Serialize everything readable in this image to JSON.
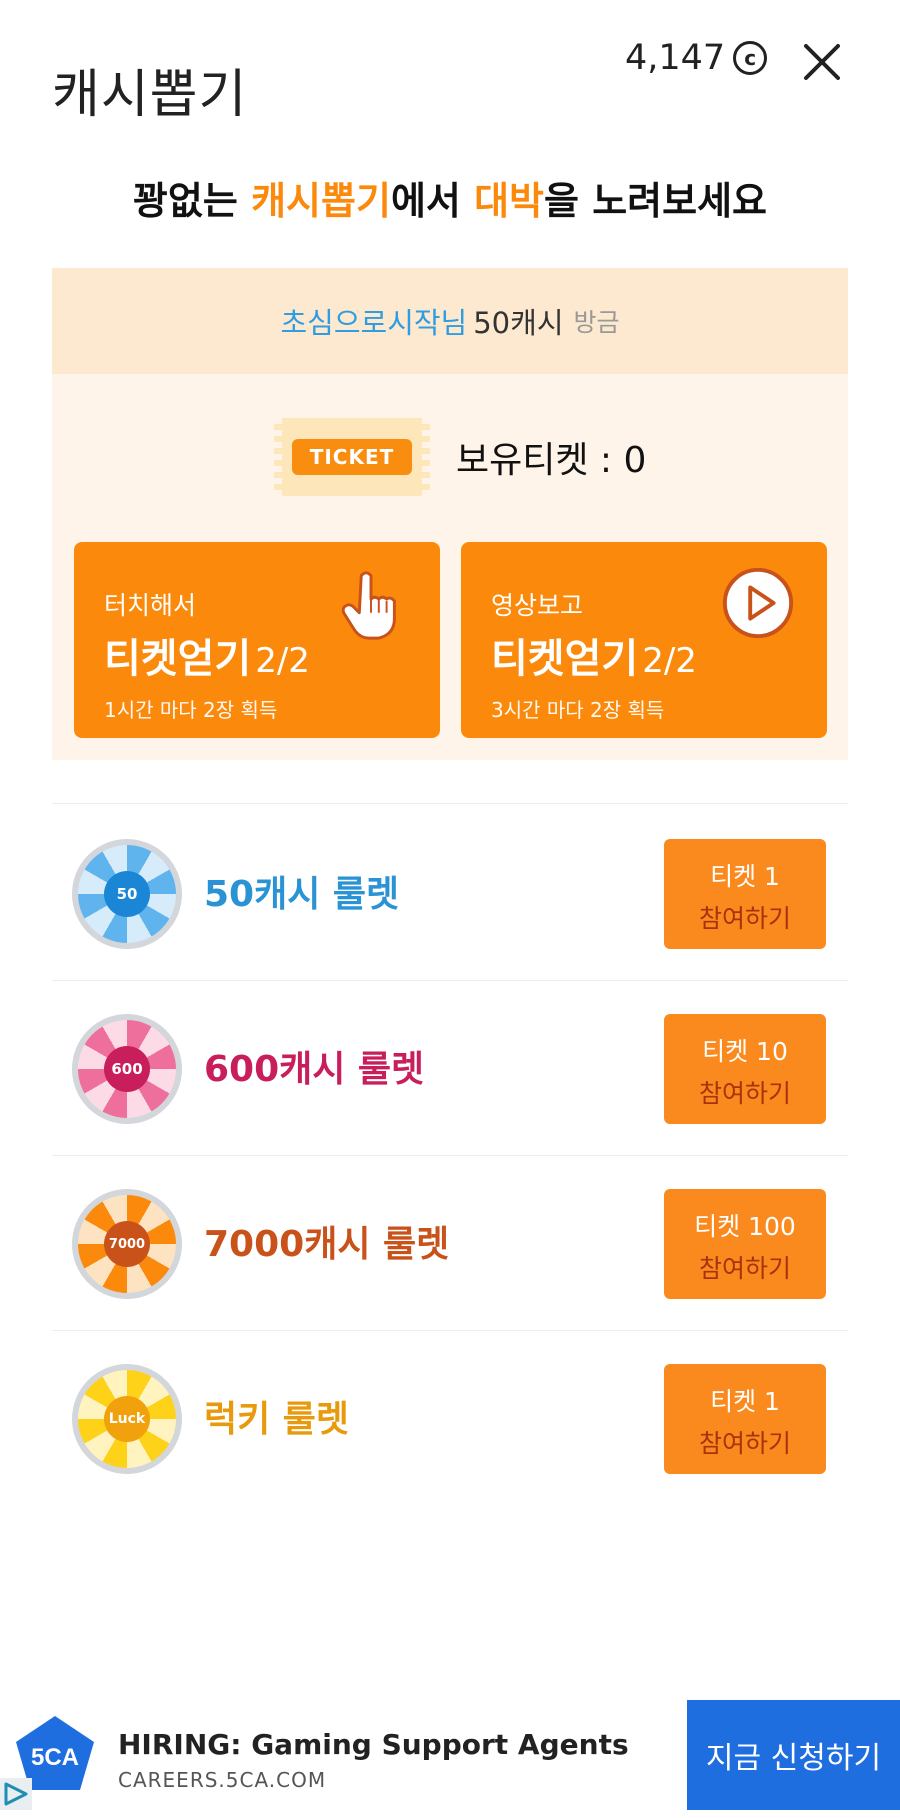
{
  "header": {
    "title": "캐시뽑기",
    "balance": "4,147",
    "cash_symbol": "c",
    "headline_a": "꽝없는 ",
    "headline_b": "캐시뽑기",
    "headline_c": "에서 ",
    "headline_d": "대박",
    "headline_e": "을 노려보세요"
  },
  "notice": {
    "user": "초심으로시작님",
    "amount": "50캐시",
    "time": "방금"
  },
  "ticket": {
    "tag": "TICKET",
    "count_text": "보유티켓 : 0"
  },
  "earn": [
    {
      "small": "터치해서",
      "big": "티켓얻기",
      "frac": "2/2",
      "note": "1시간 마다 2장 획득",
      "icon": "hand-pointer-icon"
    },
    {
      "small": "영상보고",
      "big": "티켓얻기",
      "frac": "2/2",
      "note": "3시간 마다 2장 획득",
      "icon": "play-icon"
    }
  ],
  "roulettes": [
    {
      "name": "50캐시 룰렛",
      "badge": "50",
      "cost": "티켓 1",
      "action": "참여하기",
      "color": "#2a93d5"
    },
    {
      "name": "600캐시 룰렛",
      "badge": "600",
      "cost": "티켓 10",
      "action": "참여하기",
      "color": "#c81e5b"
    },
    {
      "name": "7000캐시 룰렛",
      "badge": "7000",
      "cost": "티켓 100",
      "action": "참여하기",
      "color": "#c9521a"
    },
    {
      "name": "럭키 룰렛",
      "badge": "Luck",
      "cost": "티켓 1",
      "action": "참여하기",
      "color": "#e89a0c"
    }
  ],
  "ad": {
    "logo_text": "5CA",
    "title": "HIRING: Gaming Support Agents",
    "url": "CAREERS.5CA.COM",
    "cta": "지금 신청하기"
  },
  "colors": {
    "accent": "#fb8a0c",
    "button": "#fb8a1e",
    "ad_button": "#1f6ee0"
  }
}
